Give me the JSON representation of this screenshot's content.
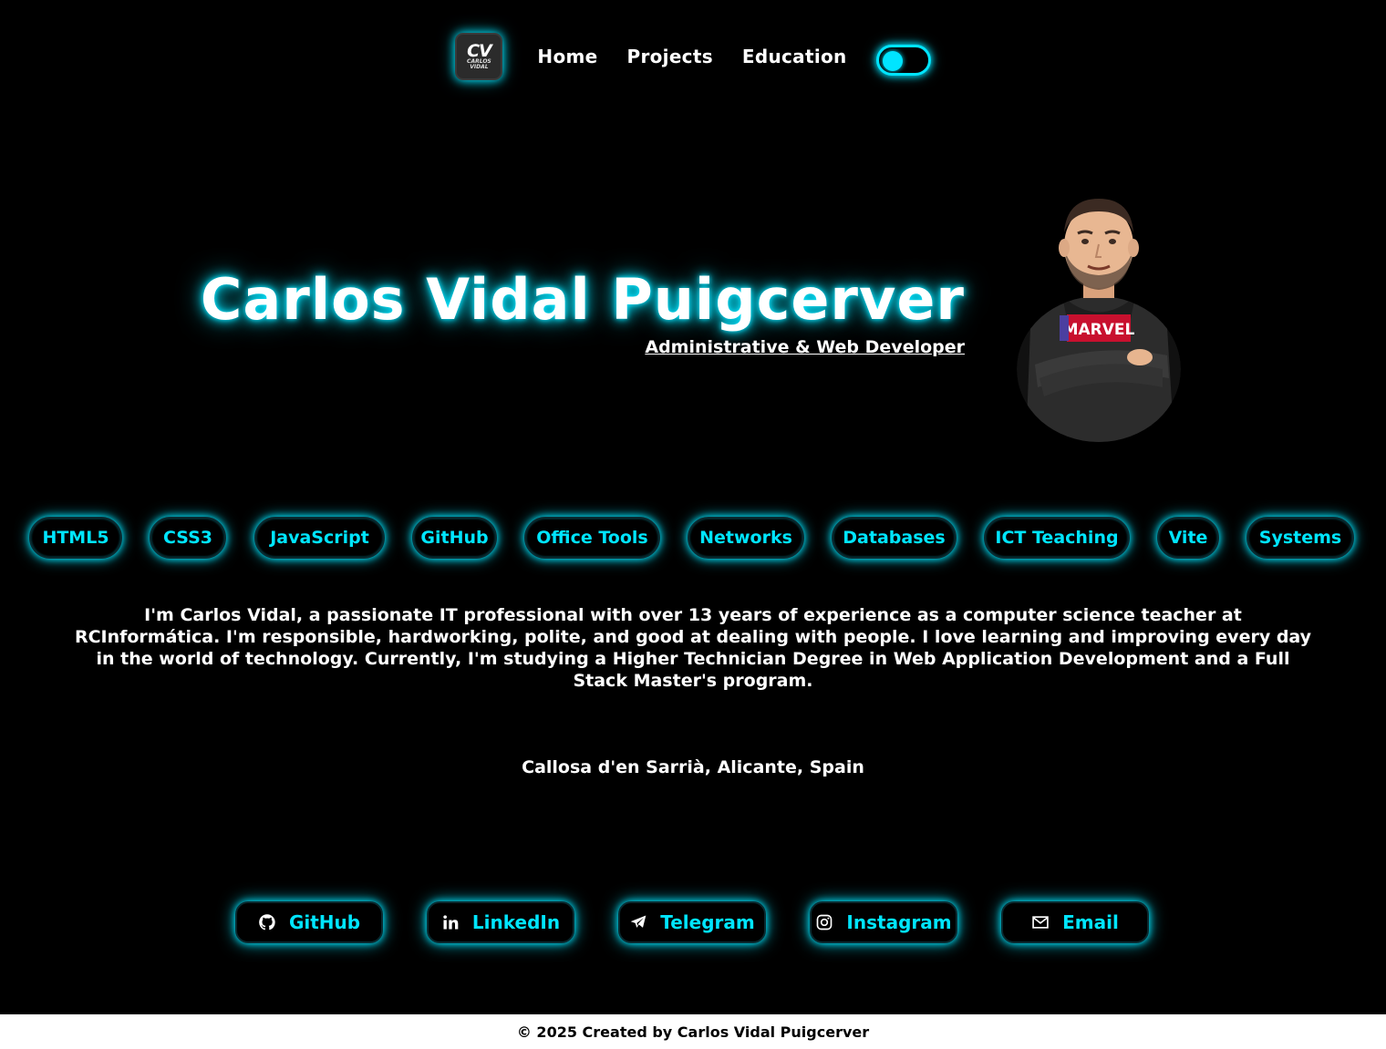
{
  "nav": {
    "logo_big": "CV",
    "logo_small_1": "CARLOS",
    "logo_small_2": "VIDAL",
    "links": [
      "Home",
      "Projects",
      "Education"
    ],
    "theme_toggle": "on"
  },
  "hero": {
    "name": "Carlos Vidal Puigcerver",
    "role": "Administrative & Web Developer",
    "avatar_icon": "cartoon-avatar-marvel-hoodie"
  },
  "skills": [
    "HTML5",
    "CSS3",
    "JavaScript",
    "GitHub",
    "Office Tools",
    "Networks",
    "Databases",
    "ICT Teaching",
    "Vite",
    "Systems"
  ],
  "bio": "I'm Carlos Vidal, a passionate IT professional with over 13 years of experience as a computer science teacher at RCInformática. I'm responsible, hardworking, polite, and good at dealing with people. I love learning and improving every day in the world of technology. Currently, I'm studying a Higher Technician Degree in Web Application Development and a Full Stack Master's program.",
  "location": "Callosa d'en Sarrià, Alicante, Spain",
  "social": [
    {
      "label": "GitHub",
      "icon": "github-icon"
    },
    {
      "label": "LinkedIn",
      "icon": "linkedin-icon"
    },
    {
      "label": "Telegram",
      "icon": "telegram-icon"
    },
    {
      "label": "Instagram",
      "icon": "instagram-icon"
    },
    {
      "label": "Email",
      "icon": "email-icon"
    }
  ],
  "footer": "© 2025 Created by Carlos Vidal Puigcerver",
  "colors": {
    "accent": "#00e5ff",
    "background": "#000000",
    "footer_bg": "#ffffff"
  }
}
